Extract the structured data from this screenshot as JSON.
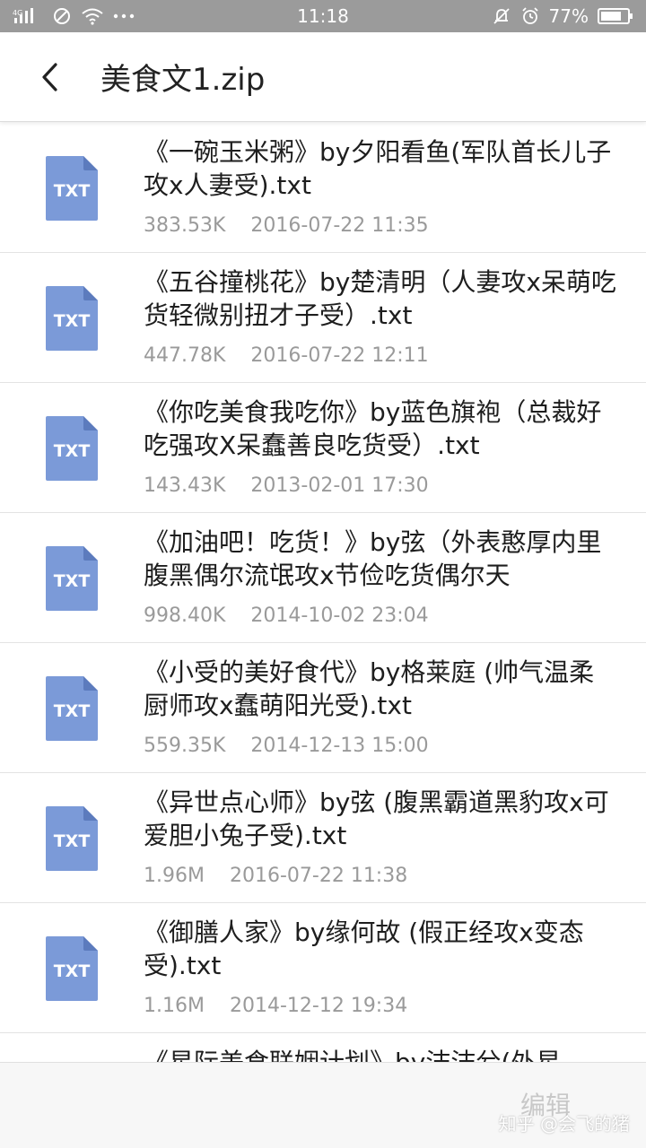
{
  "status_bar": {
    "signal_label": "4G",
    "time": "11:18",
    "battery": "77%"
  },
  "header": {
    "title": "美食文1.zip"
  },
  "file_icon_label": "TXT",
  "files": [
    {
      "name": "《一碗玉米粥》by夕阳看鱼(军队首长儿子攻x人妻受).txt",
      "size": "383.53K",
      "date": "2016-07-22 11:35"
    },
    {
      "name": "《五谷撞桃花》by楚清明（人妻攻x呆萌吃货轻微别扭才子受）.txt",
      "size": "447.78K",
      "date": "2016-07-22 12:11"
    },
    {
      "name": "《你吃美食我吃你》by蓝色旗袍（总裁好吃强攻X呆蠢善良吃货受）.txt",
      "size": "143.43K",
      "date": "2013-02-01 17:30"
    },
    {
      "name": "《加油吧！吃货！》by弦（外表憨厚内里腹黑偶尔流氓攻x节俭吃货偶尔天",
      "size": "998.40K",
      "date": "2014-10-02 23:04"
    },
    {
      "name": "《小受的美好食代》by格莱庭 (帅气温柔厨师攻x蠢萌阳光受).txt",
      "size": "559.35K",
      "date": "2014-12-13 15:00"
    },
    {
      "name": "《异世点心师》by弦 (腹黑霸道黑豹攻x可爱胆小兔子受).txt",
      "size": "1.96M",
      "date": "2016-07-22 11:38"
    },
    {
      "name": "《御膳人家》by缘何故 (假正经攻x变态受).txt",
      "size": "1.16M",
      "date": "2014-12-12 19:34"
    },
    {
      "name": "《星际美食联姻计划》by沫沫兮(外星",
      "size": "",
      "date": ""
    }
  ],
  "bottom_bar": {
    "edit_label": "编辑",
    "watermark": "知乎 @会飞的猪"
  },
  "colors": {
    "status_bar_bg": "#9b9b9b",
    "file_icon": "#7b9ad8",
    "meta_text": "#9a9a9a"
  }
}
